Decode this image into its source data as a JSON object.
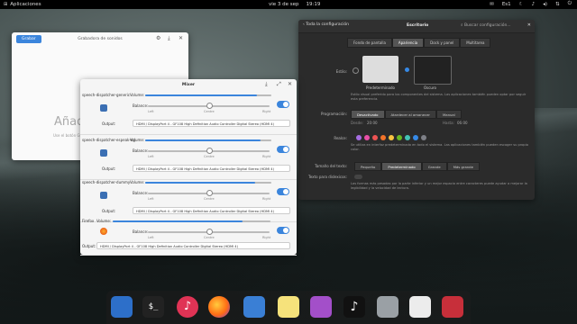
{
  "panel": {
    "apps_label": "Aplicaciones",
    "date": "vie 3 de sep",
    "time": "19:19",
    "kb_layout": "Es1"
  },
  "recorder": {
    "record_button": "Grabar",
    "title": "Grabadora de sonidos",
    "big_text": "Añad",
    "sub_text": "Use el botón Grab"
  },
  "mixer": {
    "title": "Mixer",
    "volume_label": "Volume:",
    "balance_label": "Balance:",
    "output_label": "Output:",
    "tick_left": "Left",
    "tick_center": "Centre",
    "tick_right": "Right",
    "streams": [
      {
        "name": "speech-dispatcher-generic",
        "output": "HDMI / DisplayPort 4 - GF108 High Definition Audio Controller Digital Stereo (HDMI 4)",
        "volume": 0.92
      },
      {
        "name": "speech-dispatcher-espeak-ng",
        "output": "HDMI / DisplayPort 4 - GF108 High Definition Audio Controller Digital Stereo (HDMI 4)",
        "volume": 0.95
      },
      {
        "name": "speech-dispatcher-dummy",
        "output": "HDMI / DisplayPort 4 - GF108 High Definition Audio Controller Digital Stereo (HDMI 4)",
        "volume": 0.9
      },
      {
        "name": "Firefox",
        "output": "HDMI / DisplayPort 4 - GF108 High Definition Audio Controller Digital Stereo (HDMI 4)",
        "volume": 0.82
      }
    ]
  },
  "settings": {
    "back_label": "Toda la configuración",
    "title": "Escritorio",
    "search_placeholder": "Buscar configuración...",
    "tabs": [
      "Fondo de pantalla",
      "Apariencia",
      "Dock y panel",
      "Multitarea"
    ],
    "active_tab": 1,
    "style_label": "Estilo:",
    "style_default": "Predeterminado",
    "style_dark": "Oscuro",
    "style_desc": "Estilo visual preferido para los componentes del sistema. Las aplicaciones también pueden optar por seguir esta preferencia.",
    "schedule_label": "Programación:",
    "schedule_options": [
      "Desactivado",
      "Atardecer al amanecer",
      "Manual"
    ],
    "from_label": "Desde:",
    "from_value": "20:00",
    "to_label": "Hasta:",
    "to_value": "06:00",
    "accent_label": "Realce:",
    "accent_colors": [
      "#a56de2",
      "#e84fa7",
      "#ed5353",
      "#f37329",
      "#f9c440",
      "#68b723",
      "#43c4b6",
      "#3689e6",
      "#7e8087"
    ],
    "accent_desc": "Se utiliza en interfaz predeterminada en todo el sistema. Las aplicaciones también pueden escoger su propio color.",
    "text_size_label": "Tamaño del texto:",
    "text_size_options": [
      "Pequeño",
      "Predeterminado",
      "Grande",
      "Más grande"
    ],
    "dyslexia_label": "Texto para dislexicos:",
    "dyslexia_desc": "Las formas más pesadas por la parte inferior y un mejor espacio entre caracteres puede ayudar a mejorar la legibilidad y la velocidad de lectura."
  },
  "dock": {
    "apps": [
      "multitasking-icon",
      "terminal-icon",
      "music-icon",
      "firefox-icon",
      "toggle-app-icon",
      "notes-icon",
      "appcenter-icon",
      "tiktok-music-icon",
      "files-icon",
      "mixer-icon",
      "media-icon"
    ]
  }
}
